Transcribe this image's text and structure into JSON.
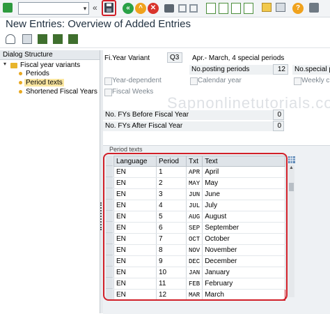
{
  "toolbar": {
    "command_value": "",
    "icons": [
      "enter-icon",
      "save-icon",
      "back-icon",
      "exit-icon",
      "cancel-icon",
      "print-icon",
      "find-icon",
      "find-next-icon",
      "first-page-icon",
      "previous-page-icon",
      "next-page-icon",
      "last-page-icon",
      "create-session-icon",
      "shortcut-icon",
      "help-icon",
      "layout-icon"
    ]
  },
  "title": "New Entries: Overview of Added Entries",
  "dialog_structure": {
    "header": "Dialog Structure",
    "items": [
      {
        "label": "Fiscal year variants",
        "level": 0,
        "type": "folder"
      },
      {
        "label": "Periods",
        "level": 1,
        "type": "leaf"
      },
      {
        "label": "Period texts",
        "level": 1,
        "type": "leaf",
        "selected": true
      },
      {
        "label": "Shortened Fiscal Years",
        "level": 1,
        "type": "leaf"
      }
    ]
  },
  "header_fields": {
    "fy_variant_label": "Fi.Year Variant",
    "fy_variant_value": "Q3",
    "fy_variant_desc": "Apr.- March, 4 special periods",
    "year_dependent_label": "Year-dependent",
    "calendar_year_label": "Calendar year",
    "weekly_label": "Weekly c",
    "fiscal_weeks_label": "Fiscal Weeks",
    "posting_periods_label": "No.posting periods",
    "posting_periods_value": "12",
    "special_periods_label": "No.special p",
    "fys_before_label": "No. FYs Before Fiscal Year",
    "fys_before_value": "0",
    "fys_after_label": "No. FYs After Fiscal Year",
    "fys_after_value": "0"
  },
  "period_texts": {
    "group_title": "Period texts",
    "columns": [
      "Language",
      "Period",
      "Txt",
      "Text"
    ],
    "rows": [
      [
        "EN",
        "1",
        "APR",
        "April"
      ],
      [
        "EN",
        "2",
        "MAY",
        "May"
      ],
      [
        "EN",
        "3",
        "JUN",
        "June"
      ],
      [
        "EN",
        "4",
        "JUL",
        "July"
      ],
      [
        "EN",
        "5",
        "AUG",
        "August"
      ],
      [
        "EN",
        "6",
        "SEP",
        "September"
      ],
      [
        "EN",
        "7",
        "OCT",
        "October"
      ],
      [
        "EN",
        "8",
        "NOV",
        "November"
      ],
      [
        "EN",
        "9",
        "DEC",
        "December"
      ],
      [
        "EN",
        "10",
        "JAN",
        "January"
      ],
      [
        "EN",
        "11",
        "FEB",
        "February"
      ],
      [
        "EN",
        "12",
        "MAR",
        "March"
      ]
    ]
  },
  "watermark": "Sapnonlinetutorials.com",
  "colors": {
    "highlight": "#d11f28",
    "selected_item": "#fbe7a1",
    "folder": "#e8b52c"
  }
}
